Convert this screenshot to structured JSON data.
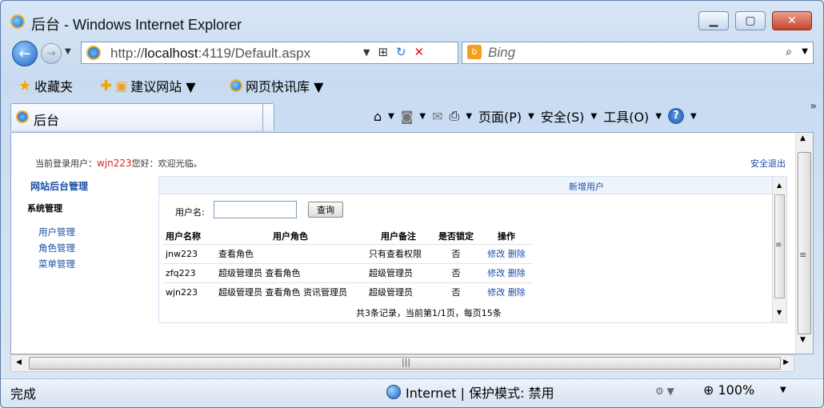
{
  "window": {
    "title": "后台 - Windows Internet Explorer"
  },
  "address": {
    "url_prefix": "http://",
    "url_host": "localhost",
    "url_rest": ":4119/Default.aspx"
  },
  "search": {
    "placeholder": "Bing"
  },
  "favorites": {
    "label": "收藏夹",
    "items": [
      "建议网站 ▼",
      "网页快讯库 ▼"
    ]
  },
  "tab": {
    "label": "后台"
  },
  "commands": {
    "page": "页面(P)",
    "safety": "安全(S)",
    "tools": "工具(O)"
  },
  "content": {
    "welcome_prefix": "当前登录用户：",
    "welcome_user": "wjn223",
    "welcome_suffix": "您好：欢迎光临。",
    "logout": "安全退出",
    "left_title": "网站后台管理",
    "left_system": "系统管理",
    "left_menu": [
      "用户管理",
      "角色管理",
      "菜单管理"
    ],
    "frame_title": "新增用户",
    "search_label": "用户名:",
    "search_value": "",
    "search_button": "查询",
    "table": {
      "headers": [
        "用户名称",
        "用户角色",
        "用户备注",
        "是否锁定",
        "操作"
      ],
      "rows": [
        {
          "name": "jnw223",
          "role": "查看角色",
          "note": "只有查看权限",
          "locked": "否",
          "edit": "修改",
          "delete": "删除"
        },
        {
          "name": "zfq223",
          "role": "超级管理员 查看角色",
          "note": "超级管理员",
          "locked": "否",
          "edit": "修改",
          "delete": "删除"
        },
        {
          "name": "wjn223",
          "role": "超级管理员 查看角色 资讯管理员",
          "note": "超级管理员",
          "locked": "否",
          "edit": "修改",
          "delete": "删除"
        }
      ]
    },
    "pager": "共3条记录，当前第1/1页，每页15条"
  },
  "status": {
    "done": "完成",
    "zone": "Internet | 保护模式: 禁用",
    "zoom": "100%"
  },
  "colors": {
    "link": "#1a4ea6",
    "user_highlight": "#dd2222"
  }
}
